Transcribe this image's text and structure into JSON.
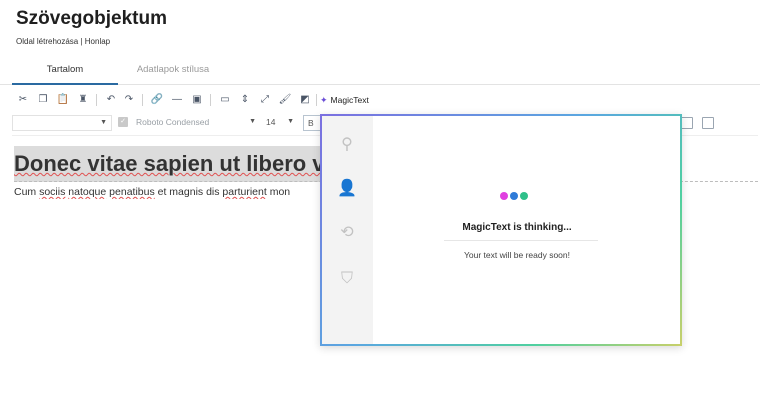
{
  "header": {
    "title": "Szövegobjektum",
    "breadcrumb": "Oldal létrehozása | Honlap"
  },
  "tabs": [
    {
      "label": "Tartalom",
      "active": true
    },
    {
      "label": "Adatlapok stílusa",
      "active": false
    }
  ],
  "toolbar": {
    "icons": [
      "cut-icon",
      "copy-icon",
      "paste-icon",
      "paste-plain-icon",
      "undo-icon",
      "redo-icon",
      "link-icon",
      "horizontal-rule-icon",
      "image-icon",
      "video-icon",
      "anchor-icon",
      "resize-icon",
      "paint-format-icon",
      "contrast-icon"
    ],
    "magic_label": "MagicText"
  },
  "format": {
    "style_value": "",
    "font_value": "Roboto Condensed",
    "size_value": "14",
    "bold_label": "B"
  },
  "editor": {
    "heading": "Donec vitae sapien ut libero venenatis",
    "body_parts": [
      "Cum ",
      "sociis",
      " ",
      "natoque",
      " ",
      "penatibus",
      " et magnis dis ",
      "parturient",
      " mon"
    ]
  },
  "magic_dialog": {
    "side_icons": [
      "magic-wand-icon",
      "user-icon",
      "history-icon",
      "shield-user-icon"
    ],
    "dot_colors": [
      "#e040e0",
      "#2f7bd8",
      "#2fc08a"
    ],
    "thinking_text": "MagicText is thinking...",
    "ready_text": "Your text will be ready soon!"
  },
  "colors": {
    "accent": "#2a6aa1",
    "dialog_border_start": "#7b6fe0",
    "dialog_border_end": "#c9d06a"
  }
}
